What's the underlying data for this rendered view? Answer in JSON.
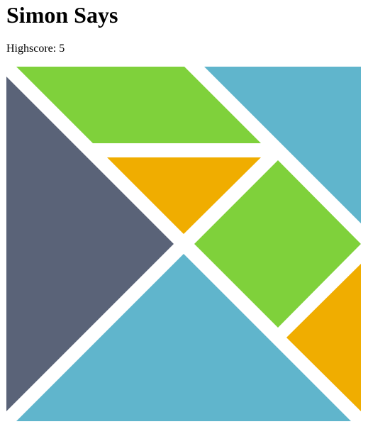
{
  "header": {
    "title": "Simon Says"
  },
  "score": {
    "label": "Highscore: 5"
  },
  "board": {
    "colors": {
      "green": "#7fd13b",
      "blue": "#60b5cc",
      "orange": "#f0ad00",
      "slate": "#5a6378"
    },
    "pieces": [
      {
        "name": "green-parallelogram-piece",
        "color": "green"
      },
      {
        "name": "top-right-blue-triangle-piece",
        "color": "blue"
      },
      {
        "name": "left-slate-triangle-piece",
        "color": "slate"
      },
      {
        "name": "center-orange-triangle-piece",
        "color": "orange"
      },
      {
        "name": "green-square-piece",
        "color": "green"
      },
      {
        "name": "bottom-right-orange-triangle-piece",
        "color": "orange"
      },
      {
        "name": "bottom-blue-triangle-piece",
        "color": "blue"
      }
    ]
  }
}
